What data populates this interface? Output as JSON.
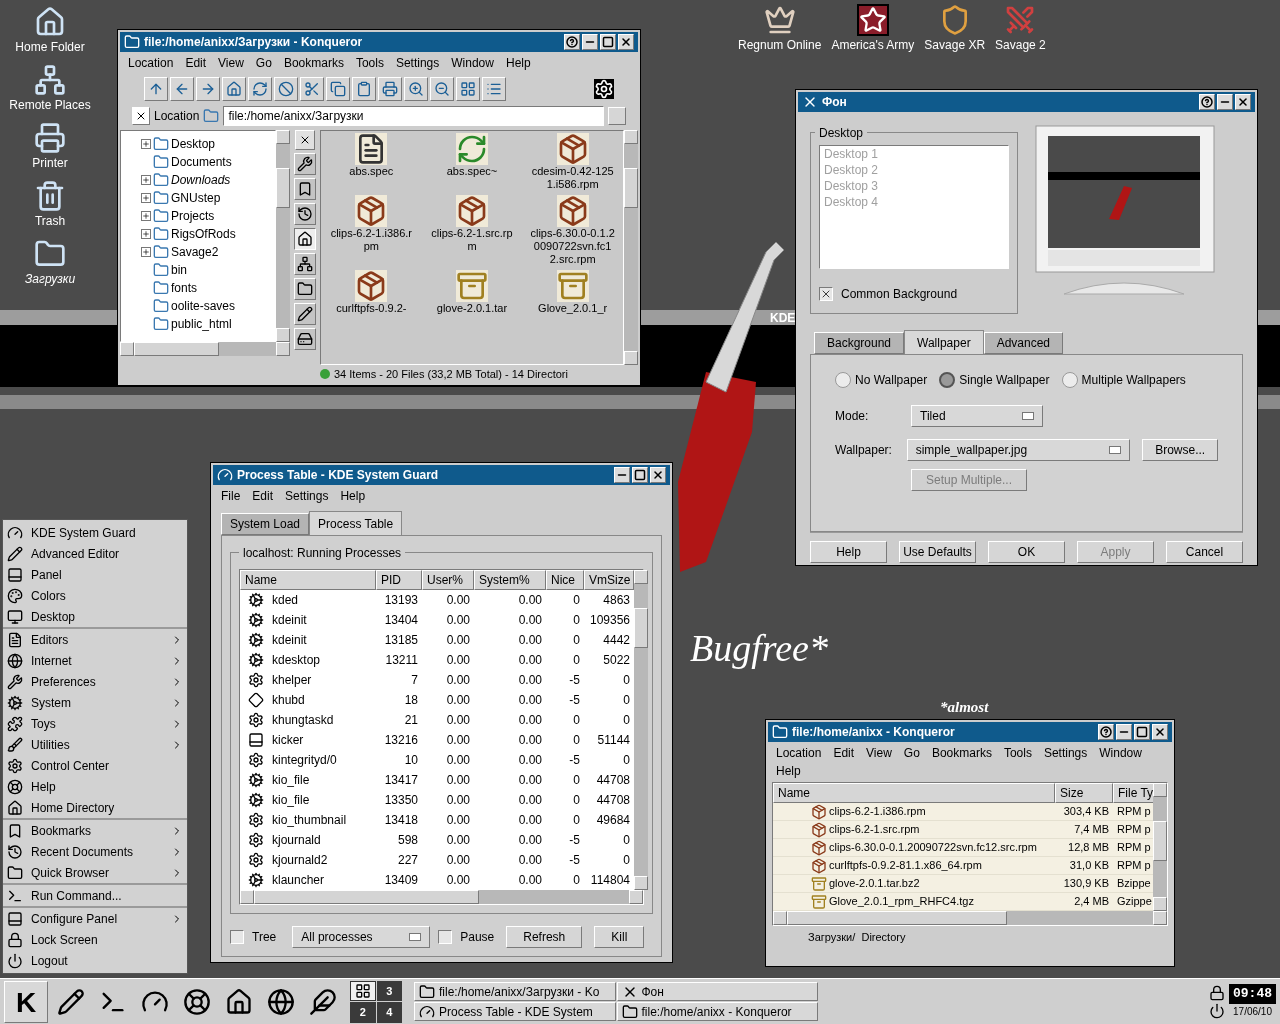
{
  "desktop_icons": [
    {
      "label": "Home Folder",
      "kind": "home"
    },
    {
      "label": "Remote Places",
      "kind": "network"
    },
    {
      "label": "Printer",
      "kind": "printer"
    },
    {
      "label": "Trash",
      "kind": "trash"
    },
    {
      "label": "Загрузки",
      "kind": "folder-link"
    }
  ],
  "game_icons": [
    {
      "label": "Regnum Online",
      "kind": "crown"
    },
    {
      "label": "America's Army",
      "kind": "star"
    },
    {
      "label": "Savage XR",
      "kind": "helmet"
    },
    {
      "label": "Savage 2",
      "kind": "swords"
    }
  ],
  "wallpaper": {
    "band_label": "KDE",
    "slogan": "Bugfree*",
    "note": "*almost"
  },
  "file_manager": {
    "title": "file:/home/anixx/Загрузки - Konqueror",
    "menu": [
      "Location",
      "Edit",
      "View",
      "Go",
      "Bookmarks",
      "Tools",
      "Settings",
      "Window",
      "Help"
    ],
    "location_label": "Location",
    "location": "file:/home/anixx/Загрузки",
    "tree": [
      {
        "label": "Desktop",
        "expandable": true,
        "symlink": false
      },
      {
        "label": "Documents",
        "expandable": false,
        "symlink": false
      },
      {
        "label": "Downloads",
        "expandable": true,
        "symlink": true
      },
      {
        "label": "GNUstep",
        "expandable": true,
        "symlink": false
      },
      {
        "label": "Projects",
        "expandable": true,
        "symlink": false
      },
      {
        "label": "RigsOfRods",
        "expandable": true,
        "symlink": false
      },
      {
        "label": "Savage2",
        "expandable": true,
        "symlink": false
      },
      {
        "label": "bin",
        "expandable": false,
        "symlink": false
      },
      {
        "label": "fonts",
        "expandable": false,
        "symlink": false
      },
      {
        "label": "oolite-saves",
        "expandable": false,
        "symlink": false
      },
      {
        "label": "public_html",
        "expandable": false,
        "symlink": false
      }
    ],
    "sidebar_tabs": [
      {
        "kind": "services",
        "selected": false
      },
      {
        "kind": "bookmarks",
        "selected": false
      },
      {
        "kind": "history",
        "selected": false
      },
      {
        "kind": "home",
        "selected": true
      },
      {
        "kind": "network",
        "selected": false
      },
      {
        "kind": "root",
        "selected": false
      },
      {
        "kind": "tools",
        "selected": false
      },
      {
        "kind": "media",
        "selected": false
      }
    ],
    "files": [
      {
        "name": "abs.spec",
        "kind": "text"
      },
      {
        "name": "abs.spec~",
        "kind": "backup"
      },
      {
        "name": "cdesim-0.42-1251.i586.rpm",
        "kind": "rpm"
      },
      {
        "name": "clips-6.2-1.i386.rpm",
        "kind": "rpm"
      },
      {
        "name": "clips-6.2-1.src.rpm",
        "kind": "rpm"
      },
      {
        "name": "clips-6.30.0-0.1.20090722svn.fc12.src.rpm",
        "kind": "rpm"
      },
      {
        "name": "curlftpfs-0.9.2-",
        "kind": "rpm"
      },
      {
        "name": "glove-2.0.1.tar",
        "kind": "archive"
      },
      {
        "name": "Glove_2.0.1_r",
        "kind": "archive"
      }
    ],
    "status": "34 Items - 20 Files (33,2 MB Total) - 14 Directori"
  },
  "background_dialog": {
    "title": "Фон",
    "desktop_group": "Desktop",
    "desktops": [
      "Desktop 1",
      "Desktop 2",
      "Desktop 3",
      "Desktop 4"
    ],
    "desktops_disabled": true,
    "common_background": {
      "label": "Common Background",
      "checked": true
    },
    "tabs": [
      {
        "label": "Background",
        "selected": false
      },
      {
        "label": "Wallpaper",
        "selected": true
      },
      {
        "label": "Advanced",
        "selected": false
      }
    ],
    "wallpaper_modes": [
      {
        "label": "No Wallpaper",
        "selected": false
      },
      {
        "label": "Single Wallpaper",
        "selected": true
      },
      {
        "label": "Multiple Wallpapers",
        "selected": false
      }
    ],
    "mode_label": "Mode:",
    "mode": "Tiled",
    "wallpaper_label": "Wallpaper:",
    "wallpaper": "simple_wallpaper.jpg",
    "browse": "Browse...",
    "setup_multiple": {
      "label": "Setup Multiple...",
      "disabled": true
    },
    "buttons": [
      {
        "label": "Help",
        "disabled": false
      },
      {
        "label": "Use Defaults",
        "disabled": false
      },
      {
        "label": "OK",
        "disabled": false
      },
      {
        "label": "Apply",
        "disabled": true
      },
      {
        "label": "Cancel",
        "disabled": false
      }
    ]
  },
  "process_monitor": {
    "title": "Process Table - KDE System Guard",
    "menu": [
      "File",
      "Edit",
      "Settings",
      "Help"
    ],
    "tabs": [
      {
        "label": "System Load",
        "selected": false
      },
      {
        "label": "Process Table",
        "selected": true
      }
    ],
    "group": "localhost: Running Processes",
    "columns": [
      "Name",
      "PID",
      "User%",
      "System%",
      "Nice",
      "VmSize"
    ],
    "rows": [
      {
        "kind": "kde",
        "cells": [
          "kded",
          "13193",
          "0.00",
          "0.00",
          "0",
          "4863"
        ]
      },
      {
        "kind": "kde",
        "cells": [
          "kdeinit",
          "13404",
          "0.00",
          "0.00",
          "0",
          "109356"
        ]
      },
      {
        "kind": "kde",
        "cells": [
          "kdeinit",
          "13185",
          "0.00",
          "0.00",
          "0",
          "4442"
        ]
      },
      {
        "kind": "kde",
        "cells": [
          "kdesktop",
          "13211",
          "0.00",
          "0.00",
          "0",
          "5022"
        ]
      },
      {
        "kind": "kernel",
        "cells": [
          "khelper",
          "7",
          "0.00",
          "0.00",
          "-5",
          "0"
        ]
      },
      {
        "kind": "usb",
        "cells": [
          "khubd",
          "18",
          "0.00",
          "0.00",
          "-5",
          "0"
        ]
      },
      {
        "kind": "kernel",
        "cells": [
          "khungtaskd",
          "21",
          "0.00",
          "0.00",
          "0",
          "0"
        ]
      },
      {
        "kind": "panel",
        "cells": [
          "kicker",
          "13216",
          "0.00",
          "0.00",
          "0",
          "51144"
        ]
      },
      {
        "kind": "kernel",
        "cells": [
          "kintegrityd/0",
          "10",
          "0.00",
          "0.00",
          "-5",
          "0"
        ]
      },
      {
        "kind": "kde",
        "cells": [
          "kio_file",
          "13417",
          "0.00",
          "0.00",
          "0",
          "44708"
        ]
      },
      {
        "kind": "kde",
        "cells": [
          "kio_file",
          "13350",
          "0.00",
          "0.00",
          "0",
          "44708"
        ]
      },
      {
        "kind": "kernel",
        "cells": [
          "kio_thumbnail",
          "13418",
          "0.00",
          "0.00",
          "0",
          "49684"
        ]
      },
      {
        "kind": "kernel",
        "cells": [
          "kjournald",
          "598",
          "0.00",
          "0.00",
          "-5",
          "0"
        ]
      },
      {
        "kind": "kernel",
        "cells": [
          "kjournald2",
          "227",
          "0.00",
          "0.00",
          "-5",
          "0"
        ]
      },
      {
        "kind": "kde",
        "cells": [
          "klauncher",
          "13409",
          "0.00",
          "0.00",
          "0",
          "114804"
        ]
      }
    ],
    "tree": {
      "label": "Tree",
      "checked": false
    },
    "filter": "All processes",
    "pause": {
      "label": "Pause",
      "checked": false
    },
    "buttons": [
      "Refresh",
      "Kill"
    ]
  },
  "file_manager_2": {
    "title": "file:/home/anixx - Konqueror",
    "menu": [
      "Location",
      "Edit",
      "View",
      "Go",
      "Bookmarks",
      "Tools",
      "Settings",
      "Window",
      "Help"
    ],
    "columns": [
      "Name",
      "Size",
      "File Ty"
    ],
    "rows": [
      {
        "kind": "rpm",
        "name": "clips-6.2-1.i386.rpm",
        "size": "303,4 KB",
        "type": "RPM p"
      },
      {
        "kind": "rpm",
        "name": "clips-6.2-1.src.rpm",
        "size": "7,4 MB",
        "type": "RPM p"
      },
      {
        "kind": "rpm",
        "name": "clips-6.30.0-0.1.20090722svn.fc12.src.rpm",
        "size": "12,8 MB",
        "type": "RPM p"
      },
      {
        "kind": "rpm",
        "name": "curlftpfs-0.9.2-81.1.x86_64.rpm",
        "size": "31,0 KB",
        "type": "RPM p"
      },
      {
        "kind": "archive",
        "name": "glove-2.0.1.tar.bz2",
        "size": "130,9 KB",
        "type": "Bzippe"
      },
      {
        "kind": "archive",
        "name": "Glove_2.0.1_rpm_RHFC4.tgz",
        "size": "2,4 MB",
        "type": "Gzippe"
      }
    ],
    "status": "Загрузки/  Directory"
  },
  "k_menu": {
    "sections": [
      [
        {
          "label": "KDE System Guard",
          "kind": "sysguard",
          "submenu": false
        },
        {
          "label": "Advanced Editor",
          "kind": "editor",
          "submenu": false
        },
        {
          "label": "Panel",
          "kind": "panel",
          "submenu": false
        },
        {
          "label": "Colors",
          "kind": "colors",
          "submenu": false
        },
        {
          "label": "Desktop",
          "kind": "desktop",
          "submenu": false
        }
      ],
      [
        {
          "label": "Editors",
          "kind": "editors",
          "submenu": true
        },
        {
          "label": "Internet",
          "kind": "internet",
          "submenu": true
        },
        {
          "label": "Preferences",
          "kind": "preferences",
          "submenu": true
        },
        {
          "label": "System",
          "kind": "system",
          "submenu": true
        },
        {
          "label": "Toys",
          "kind": "toys",
          "submenu": true
        },
        {
          "label": "Utilities",
          "kind": "utilities",
          "submenu": true
        },
        {
          "label": "Control Center",
          "kind": "control",
          "submenu": false
        },
        {
          "label": "Help",
          "kind": "help",
          "submenu": false
        },
        {
          "label": "Home Directory",
          "kind": "home",
          "submenu": false
        }
      ],
      [
        {
          "label": "Bookmarks",
          "kind": "bookmarks",
          "submenu": true
        },
        {
          "label": "Recent Documents",
          "kind": "recent",
          "submenu": true
        },
        {
          "label": "Quick Browser",
          "kind": "browser",
          "submenu": true
        }
      ],
      [
        {
          "label": "Run Command...",
          "kind": "run",
          "submenu": false
        }
      ],
      [
        {
          "label": "Configure Panel",
          "kind": "configure",
          "submenu": true
        },
        {
          "label": "Lock Screen",
          "kind": "lock",
          "submenu": false
        },
        {
          "label": "Logout",
          "kind": "logout",
          "submenu": false
        }
      ]
    ]
  },
  "taskbar": {
    "start": "K",
    "pager": [
      {
        "selected": true
      },
      {
        "label": "3",
        "selected": false
      },
      {
        "label": "2",
        "selected": false
      },
      {
        "label": "4",
        "selected": false
      }
    ],
    "tasks": [
      {
        "title": "file:/home/anixx/Загрузки - Ko",
        "kind": "konqueror"
      },
      {
        "title": "Фон",
        "kind": "background"
      },
      {
        "title": "Process Table - KDE System",
        "kind": "sysguard"
      },
      {
        "title": "file:/home/anixx - Konqueror",
        "kind": "konqueror"
      }
    ],
    "clock": "09:48",
    "date": "17/06/10"
  }
}
